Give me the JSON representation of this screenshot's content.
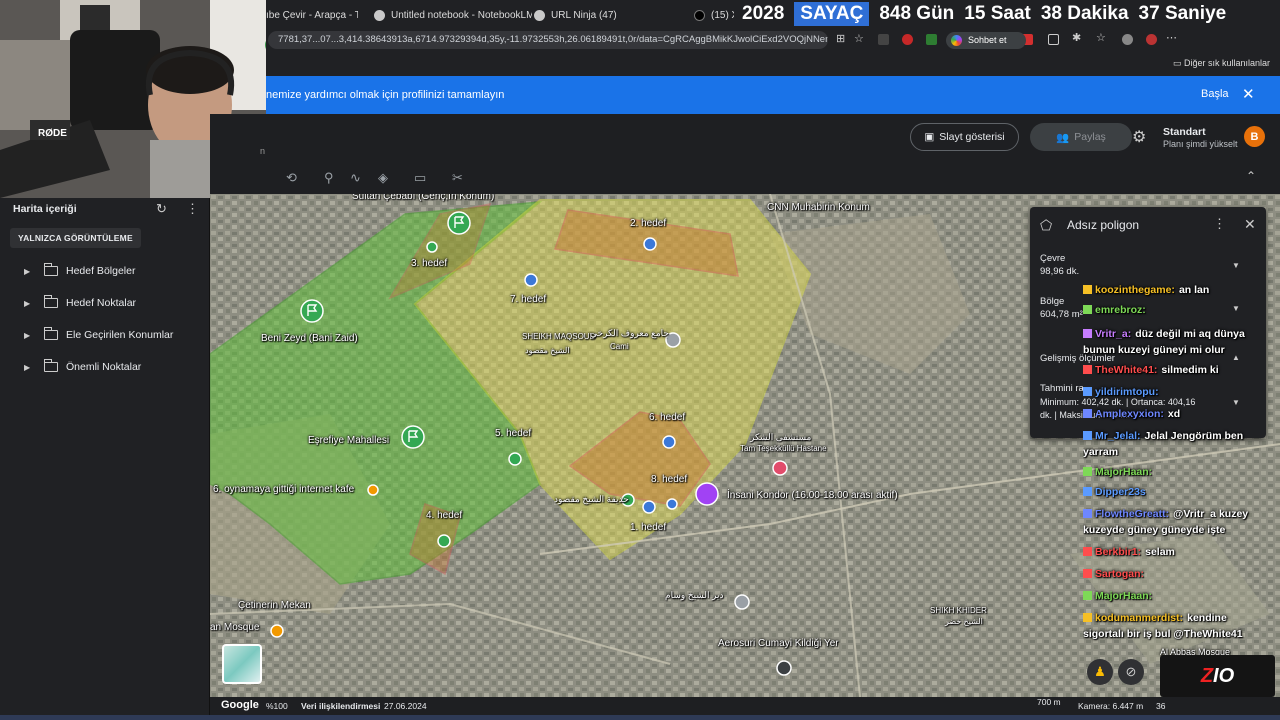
{
  "browser": {
    "tabs": [
      {
        "label": "ıbe Çevir - Arapça - T"
      },
      {
        "label": "Untitled notebook - NotebookLM"
      },
      {
        "label": "URL Ninja (47)"
      },
      {
        "label": "(15) X"
      }
    ],
    "url": "7781,37...07...3,414.38643913a,6714.97329394d,35y,-11.9732553h,26.06189491t,0r/data=CgRCAggBMikKJwolCiExd2VOQjNNem42c...",
    "chat_button": "Sohbet et",
    "bookmarks_folder": "Diğer sık kullanılanlar"
  },
  "countdown": {
    "year": "2028",
    "title": "SAYAÇ",
    "days": "848 Gün",
    "hours": "15 Saat",
    "minutes": "38 Dakika",
    "seconds": "37 Saniye"
  },
  "banner": {
    "message": "nemize yardımcı olmak için profilinizi tamamlayın",
    "action": "Başla"
  },
  "earth_header": {
    "slideshow": "Slayt gösterisi",
    "share": "Paylaş",
    "plan_name": "Standart",
    "plan_upgrade": "Planı şimdi yükselt",
    "avatar_letter": "B",
    "side_label": "n"
  },
  "sidebar": {
    "title": "Harita içeriği",
    "filter": "YALNIZCA GÖRÜNTÜLEME",
    "folders": [
      "Hedef Bölgeler",
      "Hedef Noktalar",
      "Ele Geçirilen Konumlar",
      "Önemli Noktalar"
    ]
  },
  "map_labels": {
    "top_cut": "Sultan Çebabı (Genç,İn Konum)",
    "cnn": "CNN Muhabirin Konum",
    "h2": "2. hedef",
    "h3": "3. hedef",
    "h7": "7. hedef",
    "sheikh": "SHEIKH MAQSOUD",
    "sheikh_ar": "الشيخ مقصود",
    "cami_ar": "جامع معروف الكرخي",
    "cami": "Cami",
    "beni_zeyd": "Beni Zeyd (Bani Zaid)",
    "h6": "6. hedef",
    "h5": "5. hedef",
    "esrefiye": "Eşrefiye Mahallesi",
    "hastane_ar": "مستشفى الشكر",
    "hastane": "Tam Teşekküllü Hastane",
    "h8": "8. hedef",
    "insani": "İnsani Kondor (16.00-18.00 arası aktif)",
    "kafe": "6. oynamaya gittiği internet kafe",
    "h4": "4. hedef",
    "h1": "1. hedef",
    "street_ar": "حديقة الشيخ مقصود",
    "cetin": "Çetinerin Mekan",
    "an_mosque": "an Mosque",
    "deir_ar": "دير الشيخ وسام",
    "shikh_khider": "SHIKH KHIDER",
    "shikh_khider_ar": "الشيخ خضر",
    "aerosuri": "Aerosuri Cumayi Kildiği Yer",
    "abbas": "Al Abbas Mosque"
  },
  "panel": {
    "title": "Adsız poligon",
    "perimeter_label": "Çevre",
    "perimeter_value": "98,96 dk.",
    "area_label": "Bölge",
    "area_value": "604,78 m²",
    "advanced_label": "Gelişmiş ölçümler",
    "estimate_label": "Tahmini ra",
    "estimate_line1": "Minimum: 402,42 dk. | Ortanca: 404,16",
    "estimate_line2": "dk. | Maksimum: 414..."
  },
  "chat": [
    {
      "user": "koozinthegame:",
      "msg": "an lan",
      "color": "#f6c026"
    },
    {
      "user": "emrebroz:",
      "msg": "",
      "color": "#7ed957"
    },
    {
      "user": "Vritr_a:",
      "msg": "düz değil mi aq dünya",
      "color": "#c77dff"
    },
    {
      "user": "",
      "msg": "bunun kuzeyi güneyi mi olur",
      "color": "#ffffff"
    },
    {
      "user": "TheWhite41:",
      "msg": "silmedim ki",
      "color": "#ff4d4d"
    },
    {
      "user": "yildirimtopu:",
      "msg": "",
      "color": "#5b9bff"
    },
    {
      "user": "Amplexyxion:",
      "msg": "xd",
      "color": "#6e87ff"
    },
    {
      "user": "Mr_Jelal:",
      "msg": "Jelal Jengörüm ben",
      "color": "#5b9bff"
    },
    {
      "user": "",
      "msg": "yarram",
      "color": "#ffffff"
    },
    {
      "user": "MajorHaan:",
      "msg": "",
      "color": "#7ed957"
    },
    {
      "user": "Dipper23s",
      "msg": "",
      "color": "#5b9bff"
    },
    {
      "user": "FlowtheGreatt:",
      "msg": "@Vritr_a kuzey",
      "color": "#6e87ff"
    },
    {
      "user": "",
      "msg": "kuzeyde güney güneyde işte",
      "color": "#ffffff"
    },
    {
      "user": "Berkbir1:",
      "msg": "selam",
      "color": "#ff4d4d"
    },
    {
      "user": "Sartogan:",
      "msg": "",
      "color": "#ff4d4d"
    },
    {
      "user": "MajorHaan:",
      "msg": "",
      "color": "#7ed957"
    },
    {
      "user": "kodumanmerdist:",
      "msg": "kendine",
      "color": "#f6c026"
    },
    {
      "user": "",
      "msg": "sigortalı bir iş bul @TheWhite41",
      "color": "#ffffff"
    }
  ],
  "status": {
    "zoom": "%100",
    "attribution": "Veri ilişkilendirmesi",
    "date": "27.06.2024",
    "scale": "700 m",
    "camera": "Kamera: 6.447 m",
    "extra": "36"
  },
  "brand_logo": "Z",
  "brand_logo2": "IO",
  "google": "Google",
  "colors": {
    "banner": "#1a73e8",
    "accent_avatar": "#e8710a",
    "counter_highlight": "#2f6fd6",
    "polygon_green": "#4caf50",
    "polygon_yellow": "#e6e24a",
    "target_red": "#d9534f"
  },
  "icons": [
    "tab-favicon",
    "refresh-icon",
    "menu-icon",
    "folder-icon",
    "chevron-right-icon",
    "gear-icon",
    "close-icon",
    "slideshow-icon",
    "share-icon",
    "pin-icon",
    "polygon-icon",
    "ruler-icon",
    "pegman-icon"
  ]
}
